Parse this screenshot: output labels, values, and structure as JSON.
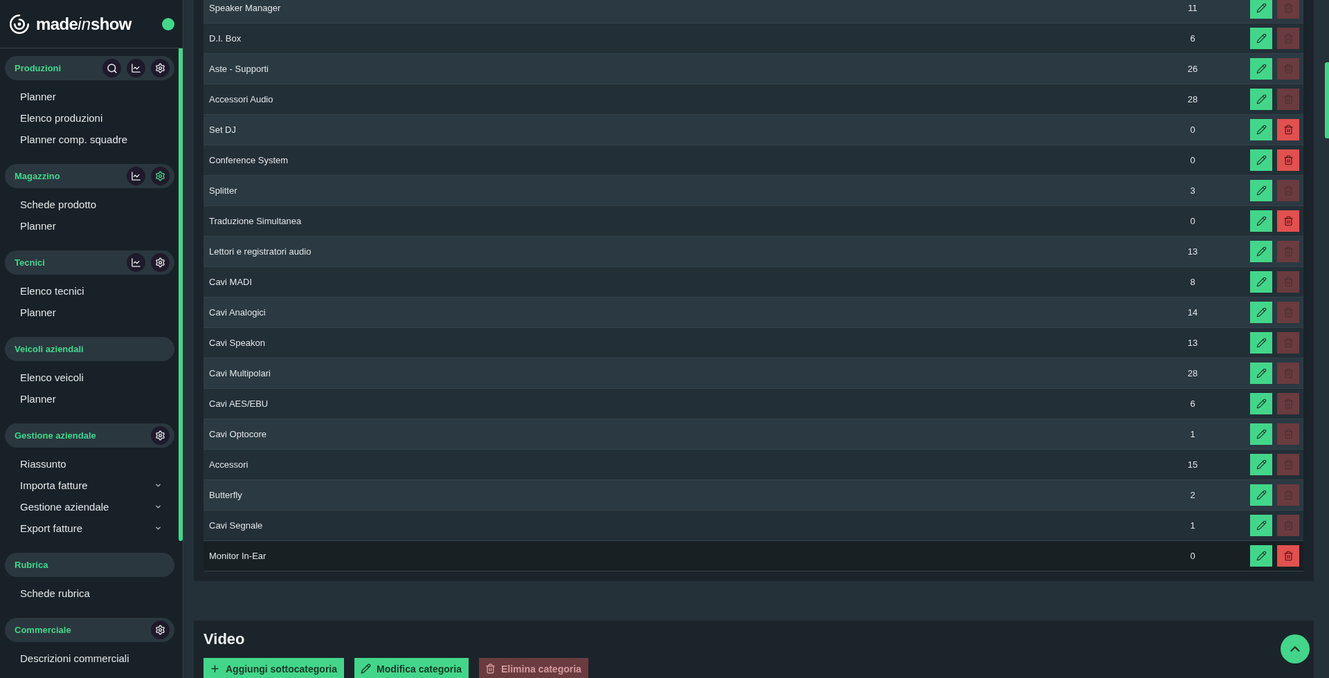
{
  "sidebar": {
    "logo": [
      {
        "text": "made",
        "italic": false
      },
      {
        "text": "in",
        "italic": true
      },
      {
        "text": "show",
        "italic": false
      }
    ],
    "online": true,
    "sections": [
      {
        "title": "Produzioni",
        "actions": [
          {
            "kind": "search",
            "active": false
          },
          {
            "kind": "chart",
            "active": false
          },
          {
            "kind": "settings",
            "active": false
          }
        ],
        "items": [
          {
            "label": "Planner",
            "kind": "link"
          },
          {
            "label": "Elenco produzioni",
            "kind": "link"
          },
          {
            "label": "Planner comp. squadre",
            "kind": "link"
          }
        ]
      },
      {
        "title": "Magazzino",
        "actions": [
          {
            "kind": "chart",
            "active": false
          },
          {
            "kind": "settings",
            "active": true
          }
        ],
        "items": [
          {
            "label": "Schede prodotto",
            "kind": "link"
          },
          {
            "label": "Planner",
            "kind": "link"
          }
        ]
      },
      {
        "title": "Tecnici",
        "actions": [
          {
            "kind": "chart",
            "active": false
          },
          {
            "kind": "settings",
            "active": false
          }
        ],
        "items": [
          {
            "label": "Elenco tecnici",
            "kind": "link"
          },
          {
            "label": "Planner",
            "kind": "link"
          }
        ]
      },
      {
        "title": "Veicoli aziendali",
        "items": [
          {
            "label": "Elenco veicoli",
            "kind": "link"
          },
          {
            "label": "Planner",
            "kind": "link"
          }
        ]
      },
      {
        "title": "Gestione aziendale",
        "actions": [
          {
            "kind": "settings",
            "active": false
          }
        ],
        "items": [
          {
            "label": "Riassunto",
            "kind": "link"
          },
          {
            "label": "Importa fatture",
            "kind": "submenu",
            "expanded": false
          },
          {
            "label": "Gestione aziendale",
            "kind": "submenu",
            "expanded": false
          },
          {
            "label": "Export fatture",
            "kind": "submenu",
            "expanded": false
          }
        ]
      },
      {
        "title": "Rubrica",
        "items": [
          {
            "label": "Schede rubrica",
            "kind": "link"
          }
        ]
      },
      {
        "title": "Commerciale",
        "actions": [
          {
            "kind": "settings",
            "active": false
          }
        ],
        "items": [
          {
            "label": "Descrizioni commerciali",
            "kind": "link"
          }
        ]
      }
    ]
  },
  "table": {
    "rows": [
      {
        "name": "Speaker Manager",
        "count": "11",
        "hovered": false,
        "delete_disabled": true
      },
      {
        "name": "D.I. Box",
        "count": "6",
        "hovered": false,
        "delete_disabled": true
      },
      {
        "name": "Aste - Supporti",
        "count": "26",
        "hovered": false,
        "delete_disabled": true
      },
      {
        "name": "Accessori Audio",
        "count": "28",
        "hovered": false,
        "delete_disabled": true
      },
      {
        "name": "Set DJ",
        "count": "0",
        "hovered": false,
        "delete_disabled": false
      },
      {
        "name": "Conference System",
        "count": "0",
        "hovered": false,
        "delete_disabled": false
      },
      {
        "name": "Splitter",
        "count": "3",
        "hovered": false,
        "delete_disabled": true
      },
      {
        "name": "Traduzione Simultanea",
        "count": "0",
        "hovered": false,
        "delete_disabled": false
      },
      {
        "name": "Lettori e registratori audio",
        "count": "13",
        "hovered": false,
        "delete_disabled": true
      },
      {
        "name": "Cavi MADI",
        "count": "8",
        "hovered": false,
        "delete_disabled": true
      },
      {
        "name": "Cavi Analogici",
        "count": "14",
        "hovered": false,
        "delete_disabled": true
      },
      {
        "name": "Cavi Speakon",
        "count": "13",
        "hovered": false,
        "delete_disabled": true
      },
      {
        "name": "Cavi Multipolari",
        "count": "28",
        "hovered": false,
        "delete_disabled": true
      },
      {
        "name": "Cavi AES/EBU",
        "count": "6",
        "hovered": false,
        "delete_disabled": true
      },
      {
        "name": "Cavi Optocore",
        "count": "1",
        "hovered": false,
        "delete_disabled": true
      },
      {
        "name": "Accessori",
        "count": "15",
        "hovered": false,
        "delete_disabled": true
      },
      {
        "name": "Butterfly",
        "count": "2",
        "hovered": false,
        "delete_disabled": true
      },
      {
        "name": "Cavi Segnale",
        "count": "1",
        "hovered": false,
        "delete_disabled": true
      },
      {
        "name": "Monitor In-Ear",
        "count": "0",
        "hovered": true,
        "delete_disabled": false
      }
    ]
  },
  "category": {
    "title": "Video",
    "buttons": [
      {
        "label": "Aggiungi sottocategoria",
        "kind": "add",
        "disabled": false
      },
      {
        "label": "Modifica categoria",
        "kind": "edit",
        "disabled": false
      },
      {
        "label": "Elimina categoria",
        "kind": "delete",
        "disabled": true
      }
    ]
  }
}
